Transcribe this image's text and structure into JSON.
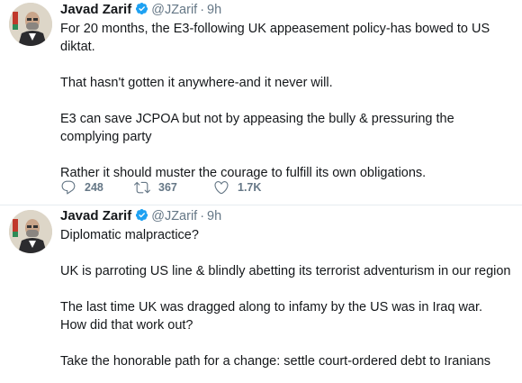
{
  "tweets": [
    {
      "name": "Javad Zarif",
      "handle": "@JZarif",
      "dot": "·",
      "time": "9h",
      "paragraphs": [
        "For 20 months, the E3-following UK appeasement policy-has bowed to US diktat.",
        "That hasn't gotten it anywhere-and it never will.",
        "E3 can save JCPOA but not by appeasing the bully & pressuring the complying party",
        "Rather it should muster the courage to fulfill its own obligations."
      ],
      "replies": "248",
      "retweets": "367",
      "likes": "1.7K"
    },
    {
      "name": "Javad Zarif",
      "handle": "@JZarif",
      "dot": "·",
      "time": "9h",
      "paragraphs": [
        "Diplomatic malpractice?",
        "UK is parroting US line & blindly abetting its terrorist adventurism in our region",
        "The last time UK was dragged along to infamy by the US was in Iraq war. How did that work out?",
        "Take the honorable path for a change: settle court-ordered debt to Iranians"
      ]
    }
  ],
  "colors": {
    "text": "#14171a",
    "secondary": "#657786",
    "verified": "#1da1f2",
    "divider": "#e6ecf0"
  },
  "icons": {
    "verified": "verified-badge-icon",
    "reply": "reply-icon",
    "retweet": "retweet-icon",
    "like": "like-icon"
  }
}
